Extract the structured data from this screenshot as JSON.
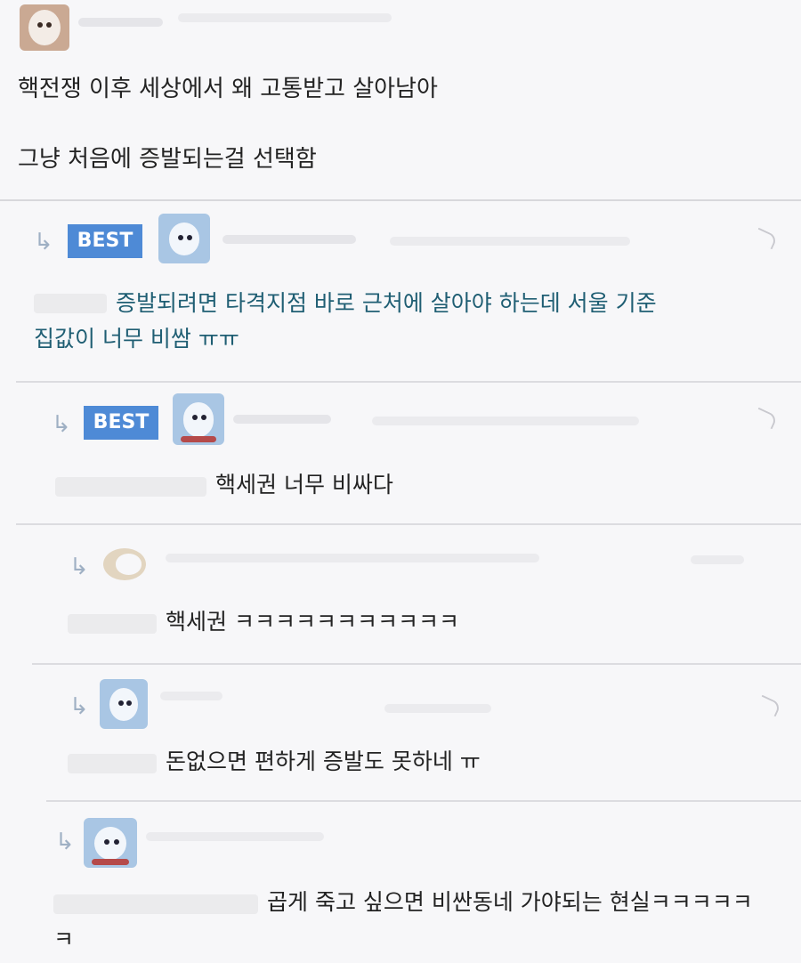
{
  "post": {
    "line1": "핵전쟁 이후 세상에서 왜 고통받고 살아남아",
    "line2": "그냥 처음에 증발되는걸 선택함"
  },
  "comments": [
    {
      "best": "BEST",
      "text": "증발되려면 타격지점 바로 근처에 살아야 하는데 서울 기준",
      "text2": "집값이 너무 비쌈 ㅠㅠ"
    },
    {
      "best": "BEST",
      "text": "핵세권 너무 비싸다"
    },
    {
      "text": "핵세권 ㅋㅋㅋㅋㅋㅋㅋㅋㅋㅋㅋ"
    },
    {
      "text": "돈없으면 편하게 증발도 못하네 ㅠ"
    },
    {
      "text": "곱게 죽고 싶으면 비싼동네 가야되는 현실ㅋㅋㅋㅋㅋ",
      "text2": "ㅋ"
    }
  ],
  "icons": {
    "avatar": "dog-avatar-icon",
    "reply": "reply-arrow-icon",
    "more": "more-options-icon"
  },
  "colors": {
    "best_badge": "#4e8ad6",
    "teal_text": "#1f5e73"
  }
}
